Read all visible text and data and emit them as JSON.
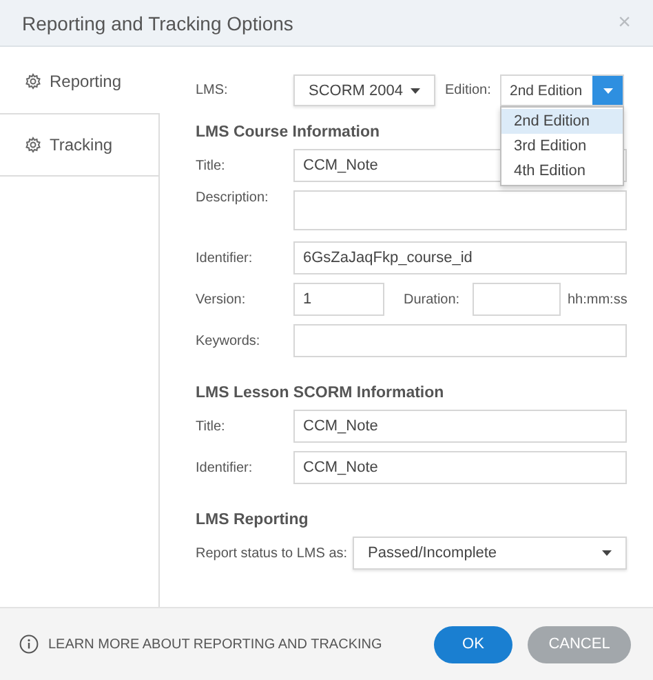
{
  "dialog": {
    "title": "Reporting and Tracking Options",
    "close": "×"
  },
  "sidebar": {
    "items": [
      {
        "label": "Reporting",
        "selected": true
      },
      {
        "label": "Tracking",
        "selected": false
      }
    ]
  },
  "lms": {
    "label": "LMS:",
    "value": "SCORM 2004",
    "edition_label": "Edition:",
    "edition_value": "2nd Edition",
    "edition_options": [
      {
        "label": "2nd Edition",
        "selected": true
      },
      {
        "label": "3rd Edition",
        "selected": false
      },
      {
        "label": "4th Edition",
        "selected": false
      }
    ]
  },
  "sections": [
    {
      "heading": "LMS Course Information",
      "fields": [
        {
          "kind": "text",
          "label": "Title:",
          "value": "CCM_Note"
        },
        {
          "kind": "textarea",
          "label": "Description:"
        },
        {
          "kind": "text",
          "label": "Identifier:",
          "value": "6GsZaJaqFkp_course_id"
        },
        {
          "kind": "pair",
          "label": "Version:",
          "value": "1",
          "label_2": "Duration:",
          "unit": "hh:mm:ss"
        },
        {
          "kind": "text",
          "label": "Keywords:"
        }
      ]
    },
    {
      "heading": "LMS Lesson SCORM Information",
      "fields": [
        {
          "kind": "text",
          "label": "Title:",
          "value": "CCM_Note"
        },
        {
          "kind": "text",
          "label": "Identifier:",
          "value": "CCM_Note"
        }
      ]
    },
    {
      "heading": "LMS Reporting",
      "fields": [
        {
          "kind": "select",
          "label": "Report status to LMS as:",
          "value": "Passed/Incomplete"
        }
      ]
    }
  ],
  "footer": {
    "link": "LEARN MORE ABOUT REPORTING AND TRACKING",
    "ok": "OK",
    "cancel": "CANCEL"
  }
}
